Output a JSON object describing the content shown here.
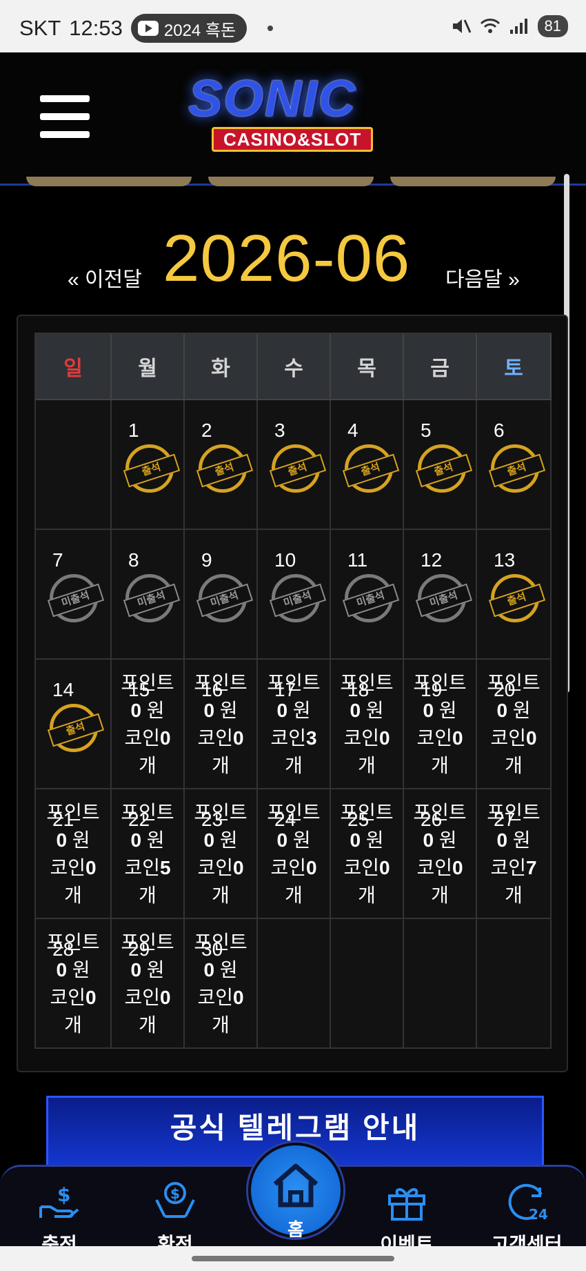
{
  "status_bar": {
    "carrier": "SKT",
    "time": "12:53",
    "media_title": "2024 흑돈",
    "battery": "81",
    "icons": [
      "youtube-icon",
      "mute-icon",
      "wifi-icon",
      "signal-icon",
      "battery-icon"
    ]
  },
  "header": {
    "logo_main": "SONIC",
    "logo_sub": "CASINO&SLOT",
    "menu_icon": "hamburger-icon"
  },
  "month_nav": {
    "prev_label": "« 이전달",
    "current_month": "2026-06",
    "next_label": "다음달 »"
  },
  "calendar": {
    "weekdays": [
      "일",
      "월",
      "화",
      "수",
      "목",
      "금",
      "토"
    ],
    "stamp_attended": "출석",
    "stamp_missed": "미출석",
    "point_label": "포인트",
    "won_unit": "원",
    "coin_label": "코인",
    "coin_unit": "개",
    "weeks": [
      [
        null,
        {
          "day": "1",
          "type": "attended"
        },
        {
          "day": "2",
          "type": "attended"
        },
        {
          "day": "3",
          "type": "attended"
        },
        {
          "day": "4",
          "type": "attended"
        },
        {
          "day": "5",
          "type": "attended"
        },
        {
          "day": "6",
          "type": "attended"
        }
      ],
      [
        {
          "day": "7",
          "type": "missed"
        },
        {
          "day": "8",
          "type": "missed"
        },
        {
          "day": "9",
          "type": "missed"
        },
        {
          "day": "10",
          "type": "missed"
        },
        {
          "day": "11",
          "type": "missed"
        },
        {
          "day": "12",
          "type": "missed"
        },
        {
          "day": "13",
          "type": "attended"
        }
      ],
      [
        {
          "day": "14",
          "type": "attended"
        },
        {
          "day": "15",
          "type": "future",
          "points": "0",
          "coins": "0"
        },
        {
          "day": "16",
          "type": "future",
          "points": "0",
          "coins": "0"
        },
        {
          "day": "17",
          "type": "future",
          "points": "0",
          "coins": "3"
        },
        {
          "day": "18",
          "type": "future",
          "points": "0",
          "coins": "0"
        },
        {
          "day": "19",
          "type": "future",
          "points": "0",
          "coins": "0"
        },
        {
          "day": "20",
          "type": "future",
          "points": "0",
          "coins": "0"
        }
      ],
      [
        {
          "day": "21",
          "type": "future",
          "points": "0",
          "coins": "0"
        },
        {
          "day": "22",
          "type": "future",
          "points": "0",
          "coins": "5"
        },
        {
          "day": "23",
          "type": "future",
          "points": "0",
          "coins": "0"
        },
        {
          "day": "24",
          "type": "future",
          "points": "0",
          "coins": "0"
        },
        {
          "day": "25",
          "type": "future",
          "points": "0",
          "coins": "0"
        },
        {
          "day": "26",
          "type": "future",
          "points": "0",
          "coins": "0"
        },
        {
          "day": "27",
          "type": "future",
          "points": "0",
          "coins": "7"
        }
      ],
      [
        {
          "day": "28",
          "type": "future",
          "points": "0",
          "coins": "0"
        },
        {
          "day": "29",
          "type": "future",
          "points": "0",
          "coins": "0"
        },
        {
          "day": "30",
          "type": "future",
          "points": "0",
          "coins": "0"
        },
        null,
        null,
        null,
        null
      ]
    ]
  },
  "banner": {
    "title": "공식 텔레그램 안내"
  },
  "bottom_nav": {
    "items": [
      {
        "label": "충전",
        "icon": "deposit-icon"
      },
      {
        "label": "환전",
        "icon": "exchange-icon"
      },
      {
        "label": "홈",
        "icon": "home-icon"
      },
      {
        "label": "이벤트",
        "icon": "gift-icon"
      },
      {
        "label": "고객센터",
        "icon": "support-24-icon"
      }
    ]
  },
  "colors": {
    "accent_gold": "#f5c93f",
    "sunday_red": "#e23b3b",
    "saturday_blue": "#6fb3ff",
    "nav_blue": "#1f6fe0"
  }
}
